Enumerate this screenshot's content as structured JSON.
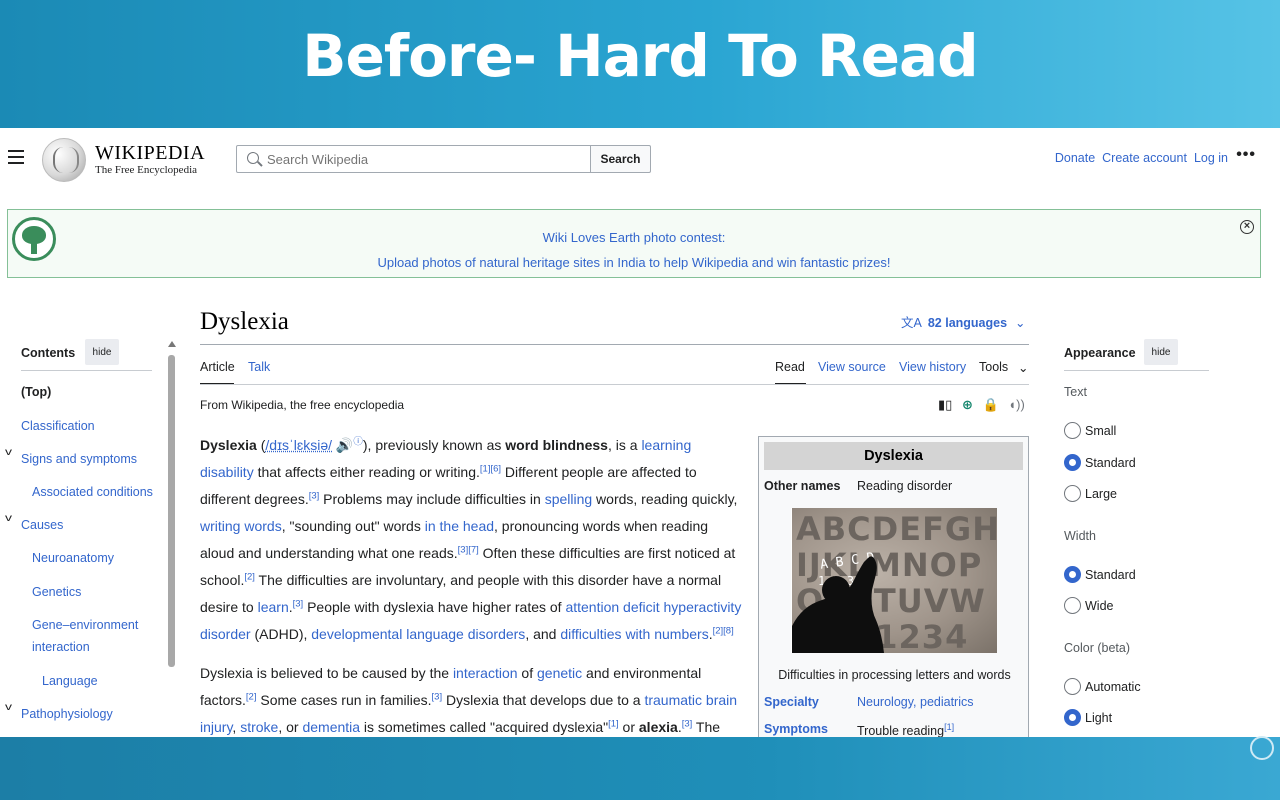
{
  "banner": {
    "title": "Before- Hard To Read"
  },
  "header": {
    "wordmark": "WIKIPEDIA",
    "tagline": "The Free Encyclopedia",
    "search_placeholder": "Search Wikipedia",
    "search_button": "Search",
    "links": [
      "Donate",
      "Create account",
      "Log in"
    ],
    "more": "•••"
  },
  "notice": {
    "line1": "Wiki Loves Earth photo contest:",
    "line2": "Upload photos of natural heritage sites in India to help Wikipedia and win fantastic prizes!",
    "close": "×"
  },
  "toc": {
    "title": "Contents",
    "hide": "hide",
    "items": [
      {
        "label": "(Top)"
      },
      {
        "label": "Classification"
      },
      {
        "label": "Signs and symptoms"
      },
      {
        "label": "Associated conditions"
      },
      {
        "label": "Causes"
      },
      {
        "label": "Neuroanatomy"
      },
      {
        "label": "Genetics"
      },
      {
        "label": "Gene–environment"
      },
      {
        "label": "interaction"
      },
      {
        "label": "Language"
      },
      {
        "label": "Pathophysiology"
      }
    ]
  },
  "article": {
    "title": "Dyslexia",
    "languages": "82 languages",
    "tabs_left": [
      "Article",
      "Talk"
    ],
    "tabs_right": [
      "Read",
      "View source",
      "View history",
      "Tools"
    ],
    "from": "From Wikipedia, the free encyclopedia"
  },
  "infobox": {
    "title": "Dyslexia",
    "other_names_label": "Other names",
    "other_names_value": "Reading disorder",
    "image_letters": [
      "ABCDEFGH",
      "IJKLMNOP",
      "QRSTUVW",
      "01234"
    ],
    "image_chalk": [
      "A B C D",
      "1 2 3 0"
    ],
    "caption": "Difficulties in processing letters and words",
    "specialty_label": "Specialty",
    "specialty_value": "Neurology, pediatrics",
    "symptoms_label": "Symptoms",
    "symptoms_value": "Trouble reading",
    "symptoms_ref": "[1]"
  },
  "appearance": {
    "title": "Appearance",
    "hide": "hide",
    "text_label": "Text",
    "text_options": [
      "Small",
      "Standard",
      "Large"
    ],
    "text_selected": "Standard",
    "width_label": "Width",
    "width_options": [
      "Standard",
      "Wide"
    ],
    "width_selected": "Standard",
    "color_label": "Color (beta)",
    "color_options": [
      "Automatic",
      "Light"
    ],
    "color_selected": "Light"
  },
  "colors": {
    "link": "#3366cc",
    "notice_border": "#84c097",
    "banner": "#2aa5d2"
  }
}
